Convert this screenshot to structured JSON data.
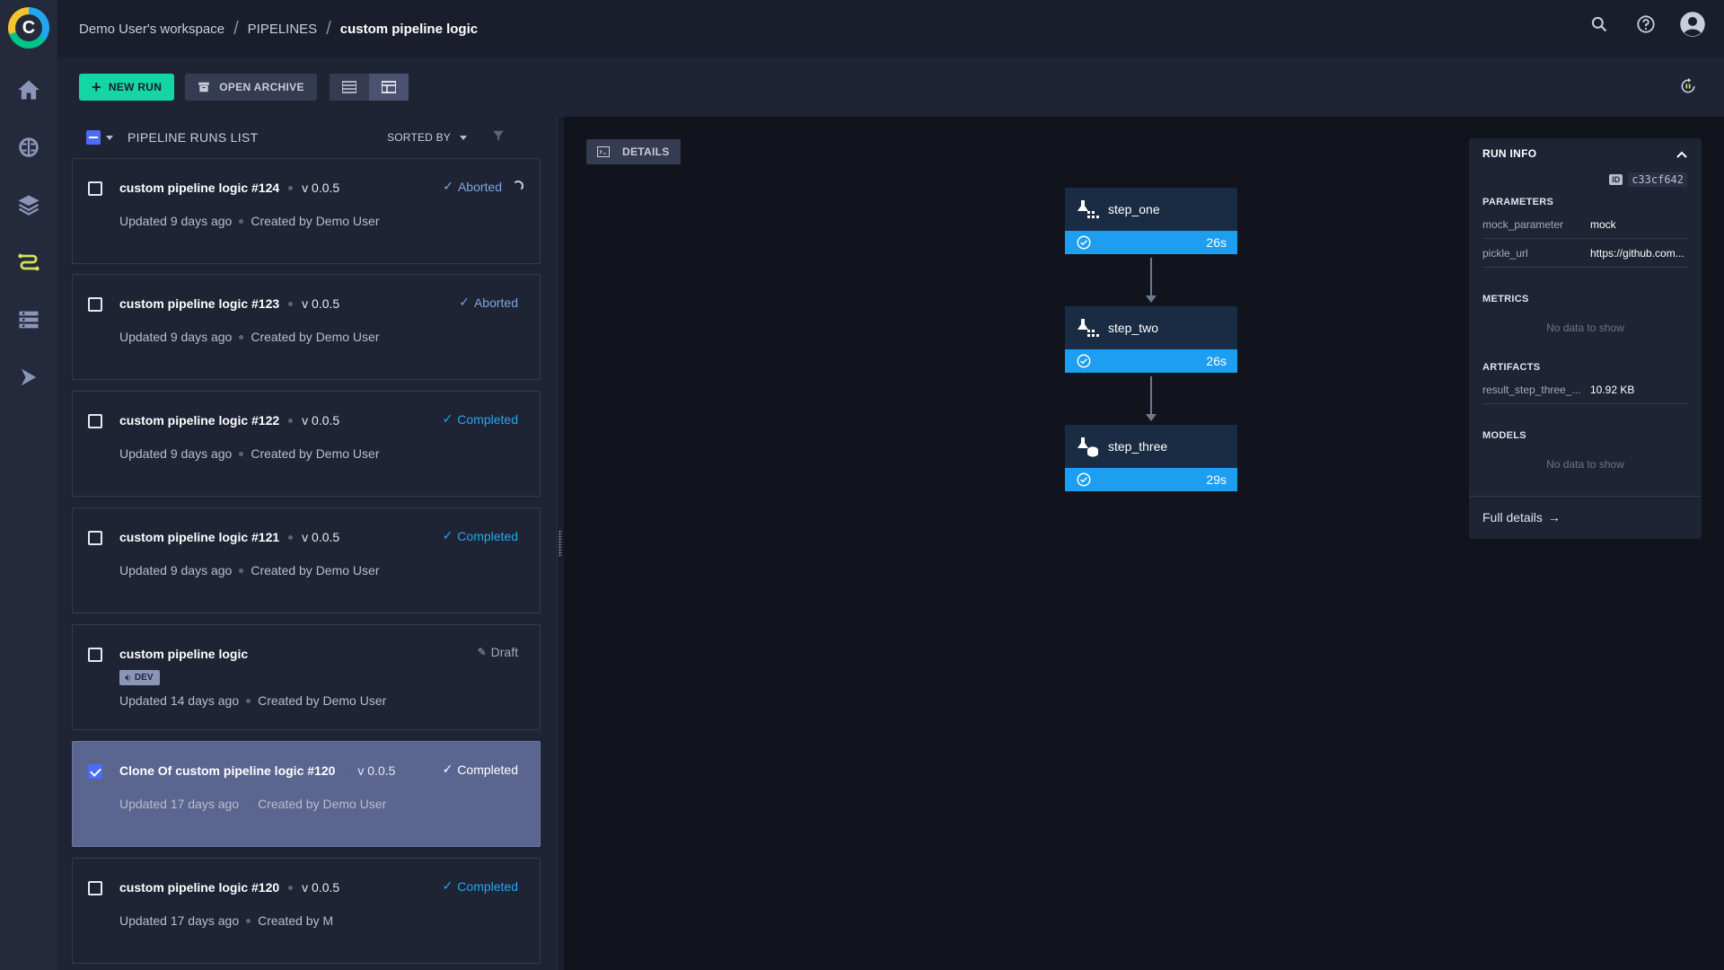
{
  "app": {
    "logo_letter": "C"
  },
  "breadcrumb": {
    "workspace": "Demo User's workspace",
    "section": "PIPELINES",
    "current": "custom pipeline logic"
  },
  "toolbar": {
    "new_run_label": "NEW RUN",
    "open_archive_label": "OPEN ARCHIVE"
  },
  "list": {
    "title": "PIPELINE RUNS LIST",
    "sorted_by_label": "SORTED BY",
    "runs": [
      {
        "name": "custom pipeline logic #124",
        "version": "v 0.0.5",
        "status": "Aborted",
        "updated": "Updated 9 days ago",
        "created": "Created by Demo User",
        "selected": false
      },
      {
        "name": "custom pipeline logic #123",
        "version": "v 0.0.5",
        "status": "Aborted",
        "updated": "Updated 9 days ago",
        "created": "Created by Demo User",
        "selected": false
      },
      {
        "name": "custom pipeline logic #122",
        "version": "v 0.0.5",
        "status": "Completed",
        "updated": "Updated 9 days ago",
        "created": "Created by Demo User",
        "selected": false
      },
      {
        "name": "custom pipeline logic #121",
        "version": "v 0.0.5",
        "status": "Completed",
        "updated": "Updated 9 days ago",
        "created": "Created by Demo User",
        "selected": false
      },
      {
        "name": "custom pipeline logic",
        "badge": "DEV",
        "status": "Draft",
        "updated": "Updated 14 days ago",
        "created": "Created by Demo User",
        "selected": false
      },
      {
        "name": "Clone Of custom pipeline logic #120",
        "version": "v 0.0.5",
        "status": "Completed",
        "updated": "Updated 17 days ago",
        "created": "Created by Demo User",
        "selected": true
      },
      {
        "name": "custom pipeline logic #120",
        "version": "v 0.0.5",
        "status": "Completed",
        "updated": "Updated 17 days ago",
        "created": "Created by M",
        "selected": false
      }
    ]
  },
  "canvas": {
    "details_label": "DETAILS",
    "steps": [
      {
        "name": "step_one",
        "duration": "26s"
      },
      {
        "name": "step_two",
        "duration": "26s"
      },
      {
        "name": "step_three",
        "duration": "29s"
      }
    ]
  },
  "run_info": {
    "title": "RUN INFO",
    "id_tag": "ID",
    "id_value": "c33cf642",
    "parameters_title": "PARAMETERS",
    "parameters": [
      {
        "key": "mock_parameter",
        "value": "mock"
      },
      {
        "key": "pickle_url",
        "value": "https://github.com..."
      }
    ],
    "metrics_title": "METRICS",
    "metrics_empty": "No data to show",
    "artifacts_title": "ARTIFACTS",
    "artifacts": [
      {
        "key": "result_step_three_...",
        "value": "10.92 KB"
      }
    ],
    "models_title": "MODELS",
    "models_empty": "No data to show",
    "full_details_label": "Full details",
    "full_details_arrow": "→"
  },
  "colors": {
    "accent_green": "#14d6a5",
    "completed_blue": "#23a6f0",
    "aborted_blue": "#7ea6e0",
    "step_bar": "#1e9ef0",
    "selected_card": "#5b6690"
  }
}
